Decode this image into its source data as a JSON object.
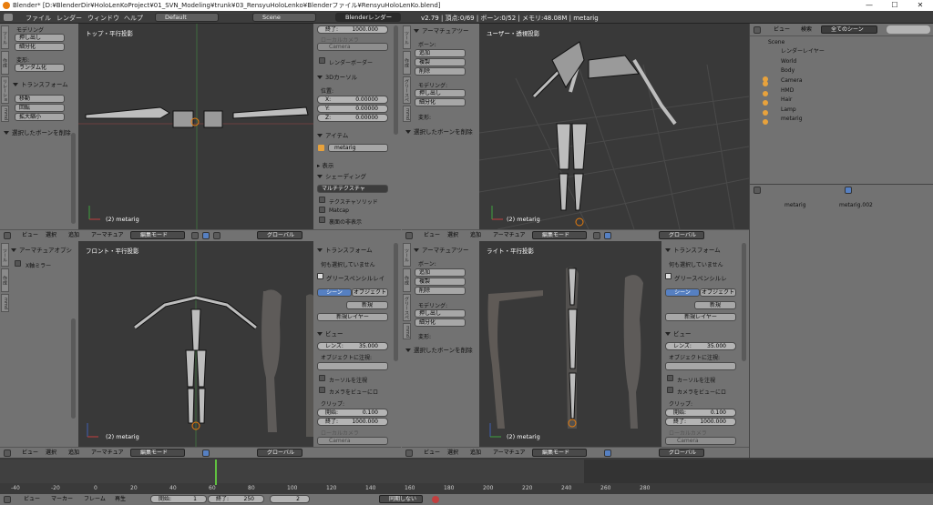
{
  "window": {
    "title": "Blender* [D:¥BlenderDir¥HoloLenKoProject¥01_SVN_Modeling¥trunk¥03_RensyuHoloLenko¥Blenderファイル¥RensyuHoloLenKo.blend]",
    "min": "—",
    "max": "☐",
    "close": "✕"
  },
  "menu": {
    "items": [
      "ファイル",
      "レンダー",
      "ウィンドウ",
      "ヘルプ"
    ],
    "layout": "Default",
    "scene": "Scene",
    "engine": "Blenderレンダー",
    "stats": "v2.79 | 頂点:0/69 | ボーン:0/52 | メモリ:48.08M | metarig"
  },
  "toolshelf_top": {
    "h_model": "モデリング",
    "extrude": "押し出し",
    "subdivide": "細分化",
    "h_deform": "変形:",
    "randomize": "ランダム化",
    "h_transform": "トランスフォーム",
    "move": "移動",
    "rotate": "回転",
    "scale": "拡大縮小",
    "delete_sel": "選択したボーンを削除"
  },
  "vp_top": {
    "label": "トップ・平行投影",
    "obj": "(2) metarig"
  },
  "props_top": {
    "end_label": "終了:",
    "end_value": "1000.000",
    "local_camera": "ローカルカメラ",
    "camera": "Camera",
    "render_border": "レンダーボーダー",
    "h_cursor": "3Dカーソル",
    "position": "位置:",
    "x_label": "X:",
    "x": "0.00000",
    "y_label": "Y:",
    "y": "0.00000",
    "z_label": "Z:",
    "z": "0.00000",
    "h_item": "アイテム",
    "item_name": "metarig",
    "h_display": "表示",
    "h_shading": "シェーディング",
    "shading_mode": "マルチテクスチャ",
    "textured_solid": "テクスチャソリッド",
    "matcap": "Matcap",
    "backface": "裏面の非表示"
  },
  "toolshelf_persp": {
    "h": "アーマチュアツー",
    "bone": "ボーン:",
    "add": "追加",
    "duplicate": "複製",
    "delete": "削除",
    "modeling": "モデリング:",
    "extrude": "押し出し",
    "subdivide": "細分化",
    "deform": "変形:",
    "delete_sel": "選択したボーンを削除"
  },
  "vp_persp": {
    "label": "ユーザー・透視投影",
    "obj": "(2) metarig"
  },
  "toolshelf_front": {
    "h": "アーマチュアオプシ",
    "xmirror": "X軸ミラー"
  },
  "vp_front": {
    "label": "フロント・平行投影",
    "obj": "(2) metarig"
  },
  "props_front": {
    "h_transform": "トランスフォーム",
    "nothing": "何も選択していません",
    "gp_layer": "グリースペンシルレイ",
    "scene": "シーン",
    "object": "オブジェクト",
    "new": "新規",
    "new_layer": "新規レイヤー",
    "h_view": "ビュー",
    "lens_label": "レンズ:",
    "lens": "35.000",
    "lock_obj": "オブジェクトに注視:",
    "lock_cursor": "カーソルを注視",
    "lock_camera": "カメラをビューにロ",
    "clip": "クリップ:",
    "start_label": "開始:",
    "start": "0.100",
    "end_label": "終了:",
    "end": "1000.000",
    "local_camera": "ローカルカメラ",
    "camera": "Camera"
  },
  "toolshelf_right": {
    "h": "アーマチュアツー",
    "bone": "ボーン:",
    "add": "追加",
    "duplicate": "複製",
    "delete": "削除",
    "modeling": "モデリング:",
    "extrude": "押し出し",
    "subdivide": "細分化",
    "deform": "変形:",
    "delete_sel": "選択したボーンを削除"
  },
  "vp_right": {
    "label": "ライト・平行投影",
    "obj": "(2) metarig"
  },
  "props_right": {
    "h_transform": "トランスフォーム",
    "nothing": "何も選択していません",
    "gp_layer": "グリースペンシルレ",
    "scene": "シーン",
    "object": "オブジェクト",
    "new": "新規",
    "new_layer": "新規レイヤー",
    "h_view": "ビュー",
    "lens_label": "レンズ:",
    "lens": "35.000",
    "lock_obj": "オブジェクトに注視:",
    "lock_cursor": "カーソルを注視",
    "lock_camera": "カメラをビューにロ",
    "clip": "クリップ:",
    "start_label": "開始:",
    "start": "0.100",
    "end_label": "終了:",
    "end": "1000.000",
    "local_camera": "ローカルカメラ",
    "camera": "Camera"
  },
  "vp_header": {
    "view": "ビュー",
    "select": "選択",
    "add": "追加",
    "armature": "アーマチュア",
    "mode": "編集モード",
    "orientation": "グローバル"
  },
  "outliner": {
    "view": "ビュー",
    "search": "検索",
    "filter": "全てのシーン",
    "rows": [
      "Scene",
      "レンダーレイヤー",
      "World",
      "Body",
      "Camera",
      "HMD",
      "Hair",
      "Lamp",
      "metarig"
    ]
  },
  "props_editor": {
    "obj": "metarig",
    "data": "metarig.002"
  },
  "timeline": {
    "ticks": [
      "-40",
      "-20",
      "0",
      "20",
      "40",
      "60",
      "80",
      "100",
      "120",
      "140",
      "160",
      "180",
      "200",
      "220",
      "240",
      "260",
      "280"
    ],
    "view": "ビュー",
    "marker": "マーカー",
    "frame": "フレーム",
    "playback": "再生",
    "start_label": "開始:",
    "start": "1",
    "end_label": "終了:",
    "end": "250",
    "current": "2",
    "sync": "同期しない"
  },
  "tabs": {
    "tool": "ツール",
    "create": "作成",
    "relations": "リレーション",
    "grease": "グリースペンシル",
    "mmd": "mmd"
  },
  "colors": {
    "accent": "#5680c2",
    "bg_viewport": "#393939",
    "panel": "#727272",
    "orange": "#e87d0d"
  }
}
